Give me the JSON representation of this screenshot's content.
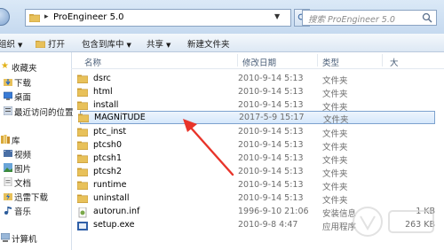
{
  "address": {
    "path": "ProEngineer 5.0",
    "search_placeholder": "搜索 ProEngineer 5.0"
  },
  "commands": {
    "organize": "组织",
    "open": "打开",
    "include_in_library": "包含到库中",
    "share": "共享",
    "new_folder": "新建文件夹"
  },
  "nav": {
    "favorites": "收藏夹",
    "downloads": "下载",
    "desktop": "桌面",
    "recent": "最近访问的位置",
    "library": "库",
    "videos": "视频",
    "pictures": "图片",
    "documents": "文档",
    "thunder": "迅雷下载",
    "music": "音乐",
    "computer": "计算机"
  },
  "columns": {
    "name": "名称",
    "modified": "修改日期",
    "type": "类型",
    "size": "大"
  },
  "files": [
    {
      "name": "dsrc",
      "date": "2010-9-14 5:13",
      "type": "文件夹",
      "size": "",
      "icon": "folder-icon"
    },
    {
      "name": "html",
      "date": "2010-9-14 5:13",
      "type": "文件夹",
      "size": "",
      "icon": "folder-icon"
    },
    {
      "name": "install",
      "date": "2010-9-14 5:13",
      "type": "文件夹",
      "size": "",
      "icon": "folder-icon"
    },
    {
      "name": "MAGNiTUDE",
      "date": "2017-5-9 15:17",
      "type": "文件夹",
      "size": "",
      "icon": "folder-icon",
      "selected": true
    },
    {
      "name": "ptc_inst",
      "date": "2010-9-14 5:13",
      "type": "文件夹",
      "size": "",
      "icon": "folder-icon"
    },
    {
      "name": "ptcsh0",
      "date": "2010-9-14 5:13",
      "type": "文件夹",
      "size": "",
      "icon": "folder-icon"
    },
    {
      "name": "ptcsh1",
      "date": "2010-9-14 5:13",
      "type": "文件夹",
      "size": "",
      "icon": "folder-icon"
    },
    {
      "name": "ptcsh2",
      "date": "2010-9-14 5:13",
      "type": "文件夹",
      "size": "",
      "icon": "folder-icon"
    },
    {
      "name": "runtime",
      "date": "2010-9-14 5:13",
      "type": "文件夹",
      "size": "",
      "icon": "folder-icon"
    },
    {
      "name": "uninstall",
      "date": "2010-9-14 5:13",
      "type": "文件夹",
      "size": "",
      "icon": "folder-icon"
    },
    {
      "name": "autorun.inf",
      "date": "1996-9-10 21:06",
      "type": "安装信息",
      "size": "1 KB",
      "icon": "inf-file-icon"
    },
    {
      "name": "setup.exe",
      "date": "2010-9-8 4:47",
      "type": "应用程序",
      "size": "263 KB",
      "icon": "exe-file-icon"
    }
  ],
  "colors": {
    "selection_border": "#7da2ce",
    "annotation_arrow": "#e8342a",
    "folder": "#e8c15a"
  }
}
